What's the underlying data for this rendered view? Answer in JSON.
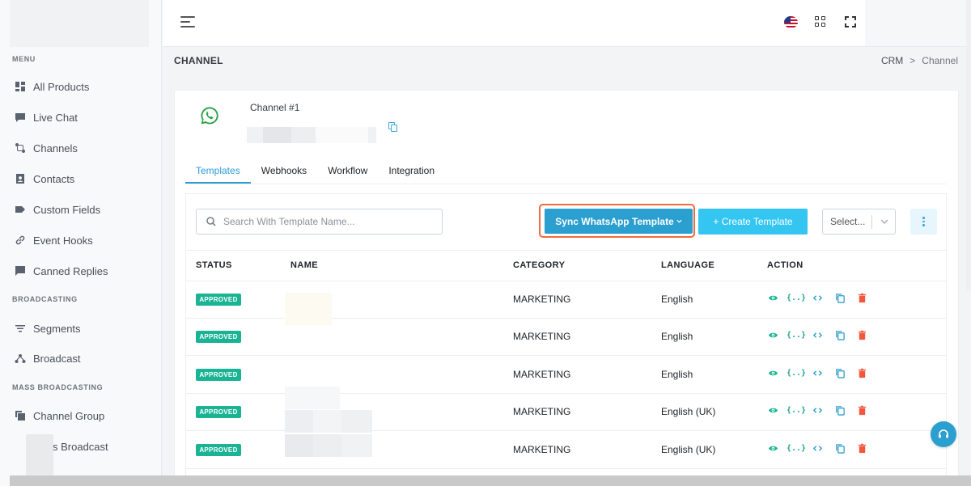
{
  "sidebar": {
    "sections": [
      {
        "title": "MENU",
        "items": [
          {
            "label": "All Products",
            "icon": "dashboard-icon"
          },
          {
            "label": "Live Chat",
            "icon": "chat-icon"
          },
          {
            "label": "Channels",
            "icon": "channels-icon"
          },
          {
            "label": "Contacts",
            "icon": "contacts-icon"
          },
          {
            "label": "Custom Fields",
            "icon": "tag-icon"
          },
          {
            "label": "Event Hooks",
            "icon": "link-icon"
          },
          {
            "label": "Canned Replies",
            "icon": "message-icon"
          }
        ]
      },
      {
        "title": "BROADCASTING",
        "items": [
          {
            "label": "Segments",
            "icon": "filter-icon"
          },
          {
            "label": "Broadcast",
            "icon": "broadcast-icon"
          }
        ]
      },
      {
        "title": "MASS BROADCASTING",
        "items": [
          {
            "label": "Channel Group",
            "icon": "copy-icon"
          },
          {
            "label": "s Broadcast",
            "icon": "broadcast-icon"
          }
        ]
      }
    ]
  },
  "header": {
    "page_title": "CHANNEL",
    "breadcrumb": [
      "CRM",
      "Channel"
    ],
    "breadcrumb_sep": ">"
  },
  "channel": {
    "name": "Channel #1"
  },
  "tabs": [
    "Templates",
    "Webhooks",
    "Workflow",
    "Integration"
  ],
  "toolbar": {
    "search_placeholder": "Search With Template Name...",
    "sync_label": "Sync WhatsApp Template",
    "create_label": "+ Create Template",
    "select_label": "Select..."
  },
  "table": {
    "columns": [
      "STATUS",
      "NAME",
      "CATEGORY",
      "LANGUAGE",
      "ACTION"
    ],
    "rows": [
      {
        "status": "APPROVED",
        "category": "MARKETING",
        "language": "English"
      },
      {
        "status": "APPROVED",
        "category": "MARKETING",
        "language": "English"
      },
      {
        "status": "APPROVED",
        "category": "MARKETING",
        "language": "English"
      },
      {
        "status": "APPROVED",
        "category": "MARKETING",
        "language": "English (UK)"
      },
      {
        "status": "APPROVED",
        "category": "MARKETING",
        "language": "English (UK)"
      }
    ],
    "action_icons": [
      "eye-icon",
      "variables-icon",
      "code-icon",
      "copy-icon",
      "trash-icon"
    ],
    "braces_text": "{..}"
  },
  "colors": {
    "accent": "#2b9fcf",
    "create": "#34c5f0",
    "approved": "#1ab394",
    "highlight": "#f26b3a",
    "delete": "#f0573c"
  }
}
